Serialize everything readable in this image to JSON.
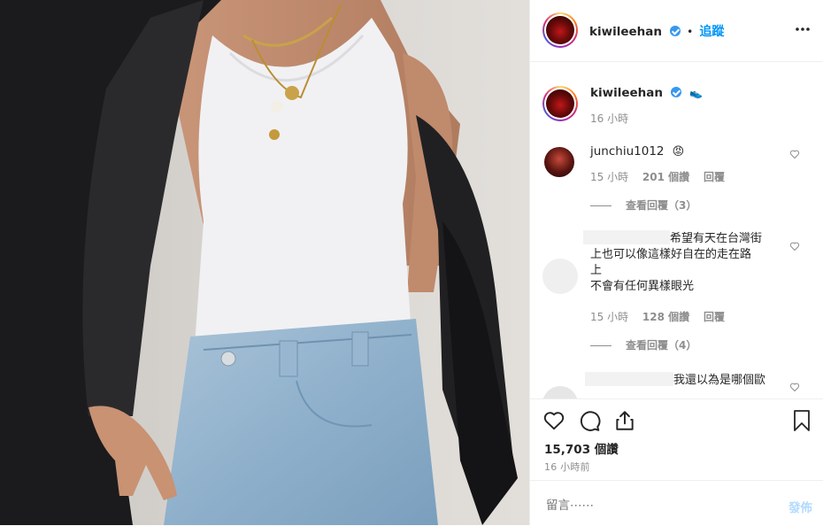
{
  "post": {
    "author": "kiwileehan",
    "follow_label": "追蹤",
    "more_icon": "more-horizontal-icon"
  },
  "caption": {
    "author": "kiwileehan",
    "emoji": "👟",
    "time": "16 小時"
  },
  "comments": [
    {
      "username": "junchiu1012",
      "emoji": "😡",
      "time": "15 小時",
      "likes": "201 個讚",
      "reply_label": "回覆",
      "view_replies": "查看回覆（3）"
    },
    {
      "text_line1": "希望有天在台灣街",
      "text_line2": "上也可以像這樣好自在的走在路",
      "text_line3": "上",
      "text_line4": "不會有任何異樣眼光",
      "time": "15 小時",
      "likes": "128 個讚",
      "reply_label": "回覆",
      "view_replies": "查看回覆（4）"
    },
    {
      "text_line1": "我還以為是哪個歐"
    }
  ],
  "stats": {
    "likes": "15,703 個讚",
    "time_ago": "16 小時前"
  },
  "composer": {
    "placeholder": "留言⋯⋯",
    "post_label": "發佈"
  }
}
